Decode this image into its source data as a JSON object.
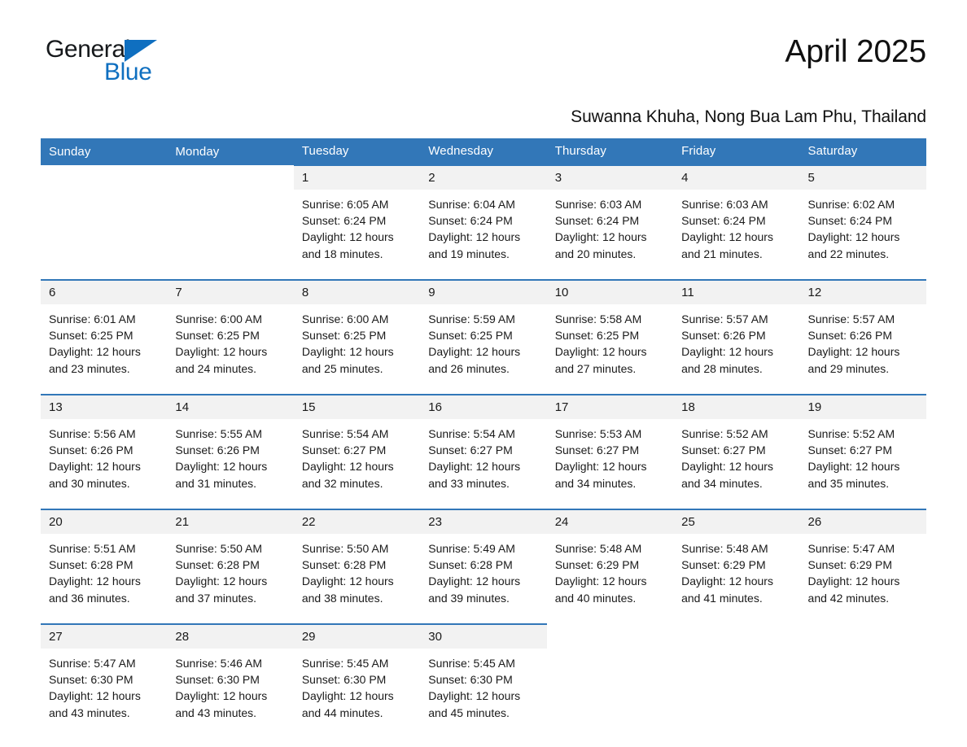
{
  "logo": {
    "word_general": "General",
    "word_blue": "Blue",
    "triangle_color": "#0f6fc0"
  },
  "header": {
    "title": "April 2025",
    "subtitle": "Suwanna Khuha, Nong Bua Lam Phu, Thailand"
  },
  "theme": {
    "header_bg": "#3277b8",
    "daynum_bg": "#f2f2f2",
    "row_rule": "#3277b8",
    "text": "#1a1a1a"
  },
  "weekday_headers": [
    "Sunday",
    "Monday",
    "Tuesday",
    "Wednesday",
    "Thursday",
    "Friday",
    "Saturday"
  ],
  "weeks": [
    [
      {
        "day": "",
        "blank": true
      },
      {
        "day": "",
        "blank": true
      },
      {
        "day": "1",
        "sunrise": "Sunrise: 6:05 AM",
        "sunset": "Sunset: 6:24 PM",
        "daylight_1": "Daylight: 12 hours",
        "daylight_2": "and 18 minutes."
      },
      {
        "day": "2",
        "sunrise": "Sunrise: 6:04 AM",
        "sunset": "Sunset: 6:24 PM",
        "daylight_1": "Daylight: 12 hours",
        "daylight_2": "and 19 minutes."
      },
      {
        "day": "3",
        "sunrise": "Sunrise: 6:03 AM",
        "sunset": "Sunset: 6:24 PM",
        "daylight_1": "Daylight: 12 hours",
        "daylight_2": "and 20 minutes."
      },
      {
        "day": "4",
        "sunrise": "Sunrise: 6:03 AM",
        "sunset": "Sunset: 6:24 PM",
        "daylight_1": "Daylight: 12 hours",
        "daylight_2": "and 21 minutes."
      },
      {
        "day": "5",
        "sunrise": "Sunrise: 6:02 AM",
        "sunset": "Sunset: 6:24 PM",
        "daylight_1": "Daylight: 12 hours",
        "daylight_2": "and 22 minutes."
      }
    ],
    [
      {
        "day": "6",
        "sunrise": "Sunrise: 6:01 AM",
        "sunset": "Sunset: 6:25 PM",
        "daylight_1": "Daylight: 12 hours",
        "daylight_2": "and 23 minutes."
      },
      {
        "day": "7",
        "sunrise": "Sunrise: 6:00 AM",
        "sunset": "Sunset: 6:25 PM",
        "daylight_1": "Daylight: 12 hours",
        "daylight_2": "and 24 minutes."
      },
      {
        "day": "8",
        "sunrise": "Sunrise: 6:00 AM",
        "sunset": "Sunset: 6:25 PM",
        "daylight_1": "Daylight: 12 hours",
        "daylight_2": "and 25 minutes."
      },
      {
        "day": "9",
        "sunrise": "Sunrise: 5:59 AM",
        "sunset": "Sunset: 6:25 PM",
        "daylight_1": "Daylight: 12 hours",
        "daylight_2": "and 26 minutes."
      },
      {
        "day": "10",
        "sunrise": "Sunrise: 5:58 AM",
        "sunset": "Sunset: 6:25 PM",
        "daylight_1": "Daylight: 12 hours",
        "daylight_2": "and 27 minutes."
      },
      {
        "day": "11",
        "sunrise": "Sunrise: 5:57 AM",
        "sunset": "Sunset: 6:26 PM",
        "daylight_1": "Daylight: 12 hours",
        "daylight_2": "and 28 minutes."
      },
      {
        "day": "12",
        "sunrise": "Sunrise: 5:57 AM",
        "sunset": "Sunset: 6:26 PM",
        "daylight_1": "Daylight: 12 hours",
        "daylight_2": "and 29 minutes."
      }
    ],
    [
      {
        "day": "13",
        "sunrise": "Sunrise: 5:56 AM",
        "sunset": "Sunset: 6:26 PM",
        "daylight_1": "Daylight: 12 hours",
        "daylight_2": "and 30 minutes."
      },
      {
        "day": "14",
        "sunrise": "Sunrise: 5:55 AM",
        "sunset": "Sunset: 6:26 PM",
        "daylight_1": "Daylight: 12 hours",
        "daylight_2": "and 31 minutes."
      },
      {
        "day": "15",
        "sunrise": "Sunrise: 5:54 AM",
        "sunset": "Sunset: 6:27 PM",
        "daylight_1": "Daylight: 12 hours",
        "daylight_2": "and 32 minutes."
      },
      {
        "day": "16",
        "sunrise": "Sunrise: 5:54 AM",
        "sunset": "Sunset: 6:27 PM",
        "daylight_1": "Daylight: 12 hours",
        "daylight_2": "and 33 minutes."
      },
      {
        "day": "17",
        "sunrise": "Sunrise: 5:53 AM",
        "sunset": "Sunset: 6:27 PM",
        "daylight_1": "Daylight: 12 hours",
        "daylight_2": "and 34 minutes."
      },
      {
        "day": "18",
        "sunrise": "Sunrise: 5:52 AM",
        "sunset": "Sunset: 6:27 PM",
        "daylight_1": "Daylight: 12 hours",
        "daylight_2": "and 34 minutes."
      },
      {
        "day": "19",
        "sunrise": "Sunrise: 5:52 AM",
        "sunset": "Sunset: 6:27 PM",
        "daylight_1": "Daylight: 12 hours",
        "daylight_2": "and 35 minutes."
      }
    ],
    [
      {
        "day": "20",
        "sunrise": "Sunrise: 5:51 AM",
        "sunset": "Sunset: 6:28 PM",
        "daylight_1": "Daylight: 12 hours",
        "daylight_2": "and 36 minutes."
      },
      {
        "day": "21",
        "sunrise": "Sunrise: 5:50 AM",
        "sunset": "Sunset: 6:28 PM",
        "daylight_1": "Daylight: 12 hours",
        "daylight_2": "and 37 minutes."
      },
      {
        "day": "22",
        "sunrise": "Sunrise: 5:50 AM",
        "sunset": "Sunset: 6:28 PM",
        "daylight_1": "Daylight: 12 hours",
        "daylight_2": "and 38 minutes."
      },
      {
        "day": "23",
        "sunrise": "Sunrise: 5:49 AM",
        "sunset": "Sunset: 6:28 PM",
        "daylight_1": "Daylight: 12 hours",
        "daylight_2": "and 39 minutes."
      },
      {
        "day": "24",
        "sunrise": "Sunrise: 5:48 AM",
        "sunset": "Sunset: 6:29 PM",
        "daylight_1": "Daylight: 12 hours",
        "daylight_2": "and 40 minutes."
      },
      {
        "day": "25",
        "sunrise": "Sunrise: 5:48 AM",
        "sunset": "Sunset: 6:29 PM",
        "daylight_1": "Daylight: 12 hours",
        "daylight_2": "and 41 minutes."
      },
      {
        "day": "26",
        "sunrise": "Sunrise: 5:47 AM",
        "sunset": "Sunset: 6:29 PM",
        "daylight_1": "Daylight: 12 hours",
        "daylight_2": "and 42 minutes."
      }
    ],
    [
      {
        "day": "27",
        "sunrise": "Sunrise: 5:47 AM",
        "sunset": "Sunset: 6:30 PM",
        "daylight_1": "Daylight: 12 hours",
        "daylight_2": "and 43 minutes."
      },
      {
        "day": "28",
        "sunrise": "Sunrise: 5:46 AM",
        "sunset": "Sunset: 6:30 PM",
        "daylight_1": "Daylight: 12 hours",
        "daylight_2": "and 43 minutes."
      },
      {
        "day": "29",
        "sunrise": "Sunrise: 5:45 AM",
        "sunset": "Sunset: 6:30 PM",
        "daylight_1": "Daylight: 12 hours",
        "daylight_2": "and 44 minutes."
      },
      {
        "day": "30",
        "sunrise": "Sunrise: 5:45 AM",
        "sunset": "Sunset: 6:30 PM",
        "daylight_1": "Daylight: 12 hours",
        "daylight_2": "and 45 minutes."
      },
      {
        "day": "",
        "blank": true
      },
      {
        "day": "",
        "blank": true
      },
      {
        "day": "",
        "blank": true
      }
    ]
  ]
}
